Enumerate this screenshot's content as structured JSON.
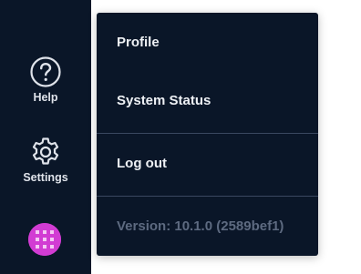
{
  "sidebar": {
    "help_label": "Help",
    "settings_label": "Settings",
    "help_icon": "help-circle-icon",
    "settings_icon": "gear-icon",
    "avatar_color": "#d23cd3"
  },
  "menu": {
    "profile_label": "Profile",
    "system_status_label": "System Status",
    "logout_label": "Log out",
    "version_text": "Version: 10.1.0 (2589bef1)"
  },
  "colors": {
    "background": "#0a1628",
    "divider": "#3a4860",
    "muted_text": "#5d6a80"
  }
}
